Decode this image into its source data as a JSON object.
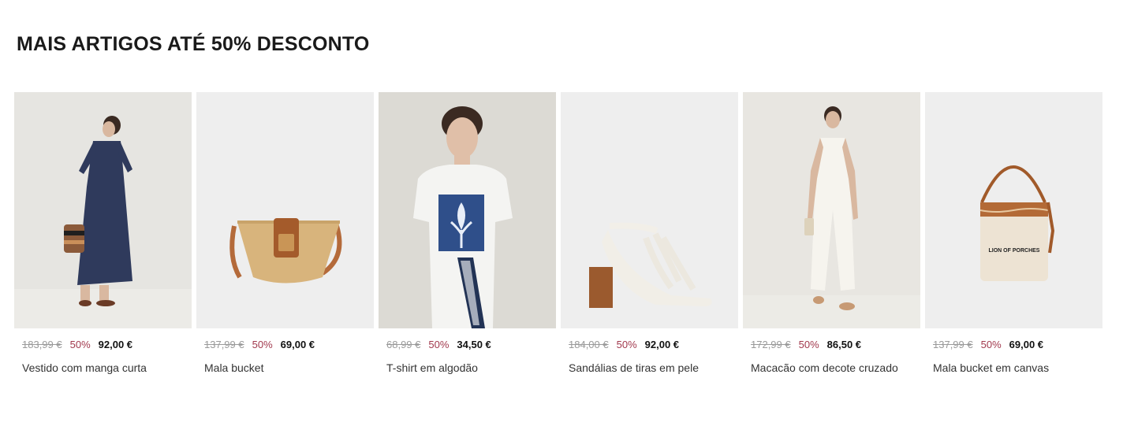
{
  "section": {
    "title": "MAIS ARTIGOS ATÉ 50% DESCONTO"
  },
  "products": [
    {
      "image": "dress-model-photo",
      "old_price": "183,99 €",
      "discount": "50%",
      "price": "92,00 €",
      "name": "Vestido com manga curta"
    },
    {
      "image": "straw-bag-photo",
      "old_price": "137,99 €",
      "discount": "50%",
      "price": "69,00 €",
      "name": "Mala bucket"
    },
    {
      "image": "tshirt-model-photo",
      "old_price": "68,99 €",
      "discount": "50%",
      "price": "34,50 €",
      "name": "T-shirt em algodão"
    },
    {
      "image": "sandals-photo",
      "old_price": "184,00 €",
      "discount": "50%",
      "price": "92,00 €",
      "name": "Sandálias de tiras em pele"
    },
    {
      "image": "jumpsuit-model-photo",
      "old_price": "172,99 €",
      "discount": "50%",
      "price": "86,50 €",
      "name": "Macacão com decote cruzado"
    },
    {
      "image": "canvas-bag-photo",
      "old_price": "137,99 €",
      "discount": "50%",
      "price": "69,00 €",
      "name": "Mala bucket em canvas",
      "bag_label": "LION OF PORCHES"
    }
  ],
  "colors": {
    "discount": "#a23a4e",
    "old_price": "#9a9a9a",
    "image_bg": "#eeeeee"
  }
}
